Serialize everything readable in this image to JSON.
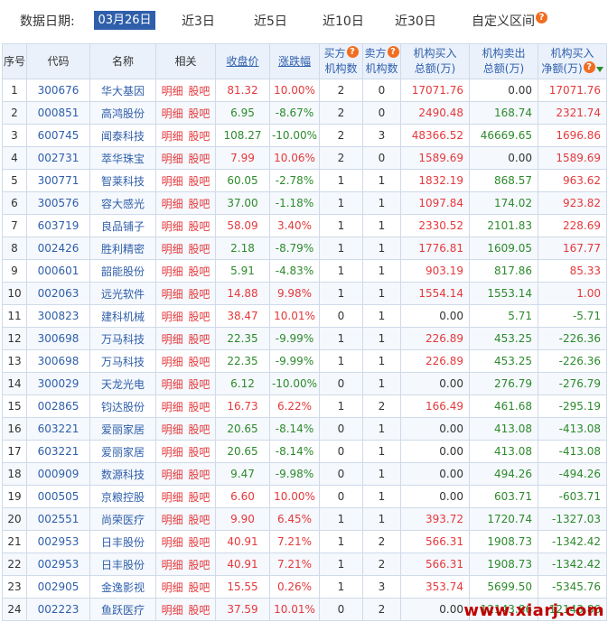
{
  "filter": {
    "label": "数据日期:",
    "date": "03月26日",
    "ranges": [
      "近3日",
      "近5日",
      "近10日",
      "近30日",
      "自定义区间"
    ]
  },
  "table": {
    "headers": {
      "seq": "序号",
      "code": "代码",
      "name": "名称",
      "related": "相关",
      "close": "收盘价",
      "change": "涨跌幅",
      "buy_count_1": "买方",
      "buy_count_2": "机构数",
      "sell_count_1": "卖方",
      "sell_count_2": "机构数",
      "buy_amt_1": "机构买入",
      "buy_amt_2": "总额(万)",
      "sell_amt_1": "机构卖出",
      "sell_amt_2": "总额(万)",
      "net_1": "机构买入",
      "net_2": "净额(万)"
    },
    "related_labels": [
      "明细",
      "股吧"
    ],
    "rows": [
      {
        "seq": "1",
        "code": "300676",
        "name": "华大基因",
        "close": "81.32",
        "change": "10.00%",
        "dir": "up",
        "buy": "2",
        "sell": "0",
        "buy_amt": "17071.76",
        "sell_amt": "0.00",
        "net": "17071.76",
        "net_dir": "up"
      },
      {
        "seq": "2",
        "code": "000851",
        "name": "高鸿股份",
        "close": "6.95",
        "change": "-8.67%",
        "dir": "down",
        "buy": "2",
        "sell": "0",
        "buy_amt": "2490.48",
        "sell_amt": "168.74",
        "net": "2321.74",
        "net_dir": "up"
      },
      {
        "seq": "3",
        "code": "600745",
        "name": "闻泰科技",
        "close": "108.27",
        "change": "-10.00%",
        "dir": "down",
        "buy": "2",
        "sell": "3",
        "buy_amt": "48366.52",
        "sell_amt": "46669.65",
        "net": "1696.86",
        "net_dir": "up"
      },
      {
        "seq": "4",
        "code": "002731",
        "name": "萃华珠宝",
        "close": "7.99",
        "change": "10.06%",
        "dir": "up",
        "buy": "2",
        "sell": "0",
        "buy_amt": "1589.69",
        "sell_amt": "0.00",
        "net": "1589.69",
        "net_dir": "up"
      },
      {
        "seq": "5",
        "code": "300771",
        "name": "智莱科技",
        "close": "60.05",
        "change": "-2.78%",
        "dir": "down",
        "buy": "1",
        "sell": "1",
        "buy_amt": "1832.19",
        "sell_amt": "868.57",
        "net": "963.62",
        "net_dir": "up"
      },
      {
        "seq": "6",
        "code": "300576",
        "name": "容大感光",
        "close": "37.00",
        "change": "-1.18%",
        "dir": "down",
        "buy": "1",
        "sell": "1",
        "buy_amt": "1097.84",
        "sell_amt": "174.02",
        "net": "923.82",
        "net_dir": "up"
      },
      {
        "seq": "7",
        "code": "603719",
        "name": "良品铺子",
        "close": "58.09",
        "change": "3.40%",
        "dir": "up",
        "buy": "1",
        "sell": "1",
        "buy_amt": "2330.52",
        "sell_amt": "2101.83",
        "net": "228.69",
        "net_dir": "up"
      },
      {
        "seq": "8",
        "code": "002426",
        "name": "胜利精密",
        "close": "2.18",
        "change": "-8.79%",
        "dir": "down",
        "buy": "1",
        "sell": "1",
        "buy_amt": "1776.81",
        "sell_amt": "1609.05",
        "net": "167.77",
        "net_dir": "up"
      },
      {
        "seq": "9",
        "code": "000601",
        "name": "韶能股份",
        "close": "5.91",
        "change": "-4.83%",
        "dir": "down",
        "buy": "1",
        "sell": "1",
        "buy_amt": "903.19",
        "sell_amt": "817.86",
        "net": "85.33",
        "net_dir": "up"
      },
      {
        "seq": "10",
        "code": "002063",
        "name": "远光软件",
        "close": "14.88",
        "change": "9.98%",
        "dir": "up",
        "buy": "1",
        "sell": "1",
        "buy_amt": "1554.14",
        "sell_amt": "1553.14",
        "net": "1.00",
        "net_dir": "up"
      },
      {
        "seq": "11",
        "code": "300823",
        "name": "建科机械",
        "close": "38.47",
        "change": "10.01%",
        "dir": "up",
        "buy": "0",
        "sell": "1",
        "buy_amt": "0.00",
        "sell_amt": "5.71",
        "net": "-5.71",
        "net_dir": "down"
      },
      {
        "seq": "12",
        "code": "300698",
        "name": "万马科技",
        "close": "22.35",
        "change": "-9.99%",
        "dir": "down",
        "buy": "1",
        "sell": "1",
        "buy_amt": "226.89",
        "sell_amt": "453.25",
        "net": "-226.36",
        "net_dir": "down"
      },
      {
        "seq": "13",
        "code": "300698",
        "name": "万马科技",
        "close": "22.35",
        "change": "-9.99%",
        "dir": "down",
        "buy": "1",
        "sell": "1",
        "buy_amt": "226.89",
        "sell_amt": "453.25",
        "net": "-226.36",
        "net_dir": "down"
      },
      {
        "seq": "14",
        "code": "300029",
        "name": "天龙光电",
        "close": "6.12",
        "change": "-10.00%",
        "dir": "down",
        "buy": "0",
        "sell": "1",
        "buy_amt": "0.00",
        "sell_amt": "276.79",
        "net": "-276.79",
        "net_dir": "down"
      },
      {
        "seq": "15",
        "code": "002865",
        "name": "钧达股份",
        "close": "16.73",
        "change": "6.22%",
        "dir": "up",
        "buy": "1",
        "sell": "2",
        "buy_amt": "166.49",
        "sell_amt": "461.68",
        "net": "-295.19",
        "net_dir": "down"
      },
      {
        "seq": "16",
        "code": "603221",
        "name": "爱丽家居",
        "close": "20.65",
        "change": "-8.14%",
        "dir": "down",
        "buy": "0",
        "sell": "1",
        "buy_amt": "0.00",
        "sell_amt": "413.08",
        "net": "-413.08",
        "net_dir": "down"
      },
      {
        "seq": "17",
        "code": "603221",
        "name": "爱丽家居",
        "close": "20.65",
        "change": "-8.14%",
        "dir": "down",
        "buy": "0",
        "sell": "1",
        "buy_amt": "0.00",
        "sell_amt": "413.08",
        "net": "-413.08",
        "net_dir": "down"
      },
      {
        "seq": "18",
        "code": "000909",
        "name": "数源科技",
        "close": "9.47",
        "change": "-9.98%",
        "dir": "down",
        "buy": "0",
        "sell": "1",
        "buy_amt": "0.00",
        "sell_amt": "494.26",
        "net": "-494.26",
        "net_dir": "down"
      },
      {
        "seq": "19",
        "code": "000505",
        "name": "京粮控股",
        "close": "6.60",
        "change": "10.00%",
        "dir": "up",
        "buy": "0",
        "sell": "1",
        "buy_amt": "0.00",
        "sell_amt": "603.71",
        "net": "-603.71",
        "net_dir": "down"
      },
      {
        "seq": "20",
        "code": "002551",
        "name": "尚荣医疗",
        "close": "9.90",
        "change": "6.45%",
        "dir": "up",
        "buy": "1",
        "sell": "1",
        "buy_amt": "393.72",
        "sell_amt": "1720.74",
        "net": "-1327.03",
        "net_dir": "down"
      },
      {
        "seq": "21",
        "code": "002953",
        "name": "日丰股份",
        "close": "40.91",
        "change": "7.21%",
        "dir": "up",
        "buy": "1",
        "sell": "2",
        "buy_amt": "566.31",
        "sell_amt": "1908.73",
        "net": "-1342.42",
        "net_dir": "down"
      },
      {
        "seq": "22",
        "code": "002953",
        "name": "日丰股份",
        "close": "40.91",
        "change": "7.21%",
        "dir": "up",
        "buy": "1",
        "sell": "2",
        "buy_amt": "566.31",
        "sell_amt": "1908.73",
        "net": "-1342.42",
        "net_dir": "down"
      },
      {
        "seq": "23",
        "code": "002905",
        "name": "金逸影视",
        "close": "15.55",
        "change": "0.26%",
        "dir": "up",
        "buy": "1",
        "sell": "3",
        "buy_amt": "353.74",
        "sell_amt": "5699.50",
        "net": "-5345.76",
        "net_dir": "down"
      },
      {
        "seq": "24",
        "code": "002223",
        "name": "鱼跃医疗",
        "close": "37.59",
        "change": "10.01%",
        "dir": "up",
        "buy": "0",
        "sell": "2",
        "buy_amt": "0.00",
        "sell_amt": "12143.86",
        "net": "-12143.86",
        "net_dir": "down"
      }
    ]
  },
  "watermark": "www.xiarj.com",
  "colors": {
    "up": "#e4393c",
    "down": "#2d8a2d",
    "accent": "#2f5faa",
    "header_bg": "#eaf1fb"
  }
}
